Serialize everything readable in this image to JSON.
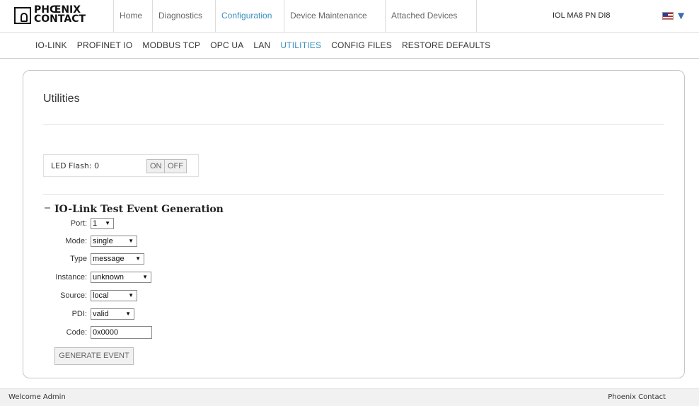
{
  "logo": {
    "line1": "PHŒNIX",
    "line2": "CONTACT"
  },
  "nav": {
    "tabs": [
      "Home",
      "Diagnostics",
      "Configuration",
      "Device Maintenance",
      "Attached Devices"
    ],
    "active": "Configuration"
  },
  "device_name": "IOL MA8 PN DI8",
  "subnav": {
    "items": [
      "IO-LINK",
      "PROFINET IO",
      "MODBUS TCP",
      "OPC UA",
      "LAN",
      "UTILITIES",
      "CONFIG FILES",
      "RESTORE DEFAULTS"
    ],
    "active": "UTILITIES"
  },
  "page": {
    "title": "Utilities",
    "led_flash": {
      "label": "LED Flash: 0",
      "on_label": "ON",
      "off_label": "OFF"
    },
    "test_event": {
      "title": "IO-Link Test Event Generation",
      "fields": {
        "port": {
          "label": "Port:",
          "value": "1"
        },
        "mode": {
          "label": "Mode:",
          "value": "single"
        },
        "type": {
          "label": "Type",
          "value": "message"
        },
        "instance": {
          "label": "Instance:",
          "value": "unknown"
        },
        "source": {
          "label": "Source:",
          "value": "local"
        },
        "pdi": {
          "label": "PDI:",
          "value": "valid"
        },
        "code": {
          "label": "Code:",
          "value": "0x0000"
        }
      },
      "generate_label": "GENERATE EVENT"
    }
  },
  "footer": {
    "welcome": "Welcome Admin",
    "brand": "Phoenix Contact"
  }
}
